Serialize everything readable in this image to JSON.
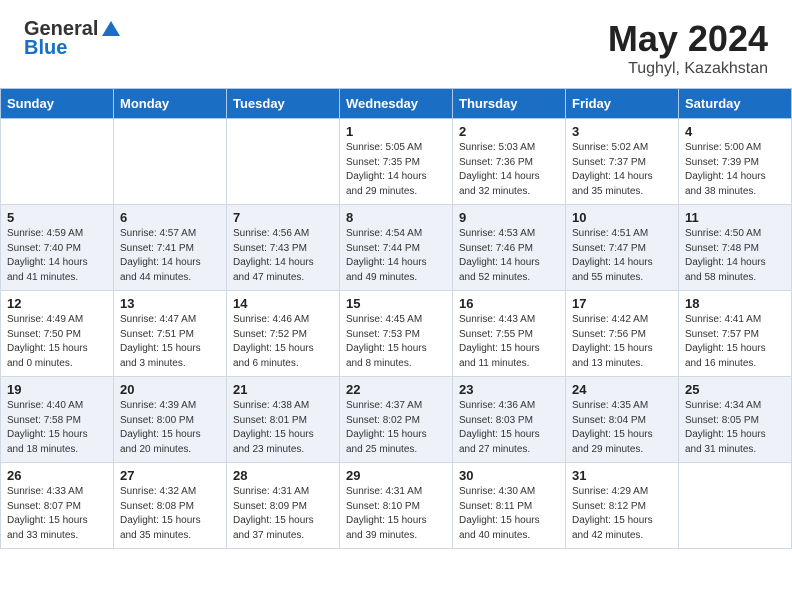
{
  "header": {
    "logo_general": "General",
    "logo_blue": "Blue",
    "main_title": "May 2024",
    "subtitle": "Tughyl, Kazakhstan"
  },
  "days_of_week": [
    "Sunday",
    "Monday",
    "Tuesday",
    "Wednesday",
    "Thursday",
    "Friday",
    "Saturday"
  ],
  "weeks": [
    [
      {
        "day": "",
        "info": ""
      },
      {
        "day": "",
        "info": ""
      },
      {
        "day": "",
        "info": ""
      },
      {
        "day": "1",
        "info": "Sunrise: 5:05 AM\nSunset: 7:35 PM\nDaylight: 14 hours\nand 29 minutes."
      },
      {
        "day": "2",
        "info": "Sunrise: 5:03 AM\nSunset: 7:36 PM\nDaylight: 14 hours\nand 32 minutes."
      },
      {
        "day": "3",
        "info": "Sunrise: 5:02 AM\nSunset: 7:37 PM\nDaylight: 14 hours\nand 35 minutes."
      },
      {
        "day": "4",
        "info": "Sunrise: 5:00 AM\nSunset: 7:39 PM\nDaylight: 14 hours\nand 38 minutes."
      }
    ],
    [
      {
        "day": "5",
        "info": "Sunrise: 4:59 AM\nSunset: 7:40 PM\nDaylight: 14 hours\nand 41 minutes."
      },
      {
        "day": "6",
        "info": "Sunrise: 4:57 AM\nSunset: 7:41 PM\nDaylight: 14 hours\nand 44 minutes."
      },
      {
        "day": "7",
        "info": "Sunrise: 4:56 AM\nSunset: 7:43 PM\nDaylight: 14 hours\nand 47 minutes."
      },
      {
        "day": "8",
        "info": "Sunrise: 4:54 AM\nSunset: 7:44 PM\nDaylight: 14 hours\nand 49 minutes."
      },
      {
        "day": "9",
        "info": "Sunrise: 4:53 AM\nSunset: 7:46 PM\nDaylight: 14 hours\nand 52 minutes."
      },
      {
        "day": "10",
        "info": "Sunrise: 4:51 AM\nSunset: 7:47 PM\nDaylight: 14 hours\nand 55 minutes."
      },
      {
        "day": "11",
        "info": "Sunrise: 4:50 AM\nSunset: 7:48 PM\nDaylight: 14 hours\nand 58 minutes."
      }
    ],
    [
      {
        "day": "12",
        "info": "Sunrise: 4:49 AM\nSunset: 7:50 PM\nDaylight: 15 hours\nand 0 minutes."
      },
      {
        "day": "13",
        "info": "Sunrise: 4:47 AM\nSunset: 7:51 PM\nDaylight: 15 hours\nand 3 minutes."
      },
      {
        "day": "14",
        "info": "Sunrise: 4:46 AM\nSunset: 7:52 PM\nDaylight: 15 hours\nand 6 minutes."
      },
      {
        "day": "15",
        "info": "Sunrise: 4:45 AM\nSunset: 7:53 PM\nDaylight: 15 hours\nand 8 minutes."
      },
      {
        "day": "16",
        "info": "Sunrise: 4:43 AM\nSunset: 7:55 PM\nDaylight: 15 hours\nand 11 minutes."
      },
      {
        "day": "17",
        "info": "Sunrise: 4:42 AM\nSunset: 7:56 PM\nDaylight: 15 hours\nand 13 minutes."
      },
      {
        "day": "18",
        "info": "Sunrise: 4:41 AM\nSunset: 7:57 PM\nDaylight: 15 hours\nand 16 minutes."
      }
    ],
    [
      {
        "day": "19",
        "info": "Sunrise: 4:40 AM\nSunset: 7:58 PM\nDaylight: 15 hours\nand 18 minutes."
      },
      {
        "day": "20",
        "info": "Sunrise: 4:39 AM\nSunset: 8:00 PM\nDaylight: 15 hours\nand 20 minutes."
      },
      {
        "day": "21",
        "info": "Sunrise: 4:38 AM\nSunset: 8:01 PM\nDaylight: 15 hours\nand 23 minutes."
      },
      {
        "day": "22",
        "info": "Sunrise: 4:37 AM\nSunset: 8:02 PM\nDaylight: 15 hours\nand 25 minutes."
      },
      {
        "day": "23",
        "info": "Sunrise: 4:36 AM\nSunset: 8:03 PM\nDaylight: 15 hours\nand 27 minutes."
      },
      {
        "day": "24",
        "info": "Sunrise: 4:35 AM\nSunset: 8:04 PM\nDaylight: 15 hours\nand 29 minutes."
      },
      {
        "day": "25",
        "info": "Sunrise: 4:34 AM\nSunset: 8:05 PM\nDaylight: 15 hours\nand 31 minutes."
      }
    ],
    [
      {
        "day": "26",
        "info": "Sunrise: 4:33 AM\nSunset: 8:07 PM\nDaylight: 15 hours\nand 33 minutes."
      },
      {
        "day": "27",
        "info": "Sunrise: 4:32 AM\nSunset: 8:08 PM\nDaylight: 15 hours\nand 35 minutes."
      },
      {
        "day": "28",
        "info": "Sunrise: 4:31 AM\nSunset: 8:09 PM\nDaylight: 15 hours\nand 37 minutes."
      },
      {
        "day": "29",
        "info": "Sunrise: 4:31 AM\nSunset: 8:10 PM\nDaylight: 15 hours\nand 39 minutes."
      },
      {
        "day": "30",
        "info": "Sunrise: 4:30 AM\nSunset: 8:11 PM\nDaylight: 15 hours\nand 40 minutes."
      },
      {
        "day": "31",
        "info": "Sunrise: 4:29 AM\nSunset: 8:12 PM\nDaylight: 15 hours\nand 42 minutes."
      },
      {
        "day": "",
        "info": ""
      }
    ]
  ]
}
